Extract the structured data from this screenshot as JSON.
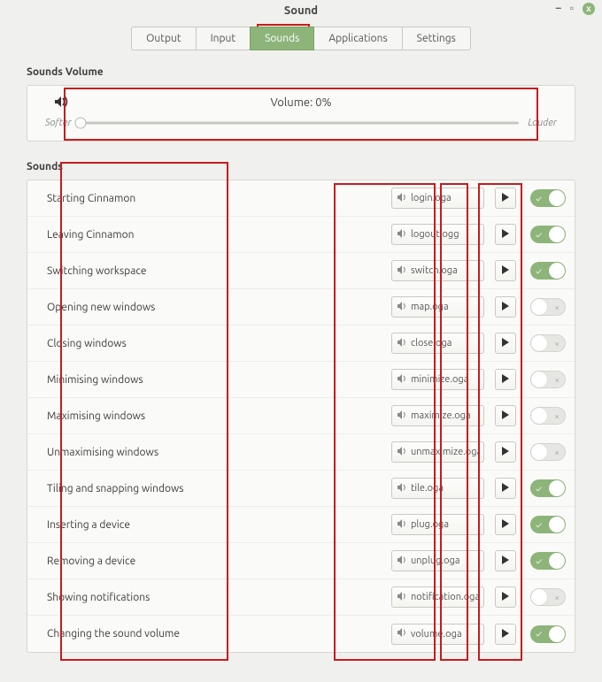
{
  "window": {
    "title": "Sound",
    "controls": {
      "min": "–",
      "max": "▫",
      "close": "x"
    }
  },
  "tabs": [
    {
      "id": "output",
      "label": "Output",
      "active": false
    },
    {
      "id": "input",
      "label": "Input",
      "active": false
    },
    {
      "id": "sounds",
      "label": "Sounds",
      "active": true
    },
    {
      "id": "apps",
      "label": "Applications",
      "active": false
    },
    {
      "id": "settings",
      "label": "Settings",
      "active": false
    }
  ],
  "volume_section": {
    "title": "Sounds Volume",
    "volume_label": "Volume: 0%",
    "softer": "Softer",
    "louder": "Louder",
    "value_percent": 0
  },
  "sounds_section": {
    "title": "Sounds",
    "rows": [
      {
        "event": "Starting Cinnamon",
        "file": "login.oga",
        "enabled": true
      },
      {
        "event": "Leaving Cinnamon",
        "file": "logout.ogg",
        "enabled": true
      },
      {
        "event": "Switching workspace",
        "file": "switch.oga",
        "enabled": true
      },
      {
        "event": "Opening new windows",
        "file": "map.oga",
        "enabled": false
      },
      {
        "event": "Closing windows",
        "file": "close.oga",
        "enabled": false
      },
      {
        "event": "Minimising windows",
        "file": "minimize.oga",
        "enabled": false
      },
      {
        "event": "Maximising windows",
        "file": "maximize.oga",
        "enabled": false
      },
      {
        "event": "Unmaximising windows",
        "file": "unmaximize.oga",
        "enabled": false
      },
      {
        "event": "Tiling and snapping windows",
        "file": "tile.oga",
        "enabled": true
      },
      {
        "event": "Inserting a device",
        "file": "plug.oga",
        "enabled": true
      },
      {
        "event": "Removing a device",
        "file": "unplug.oga",
        "enabled": true
      },
      {
        "event": "Showing notifications",
        "file": "notification.oga",
        "enabled": false
      },
      {
        "event": "Changing the sound volume",
        "file": "volume.oga",
        "enabled": true
      }
    ]
  }
}
